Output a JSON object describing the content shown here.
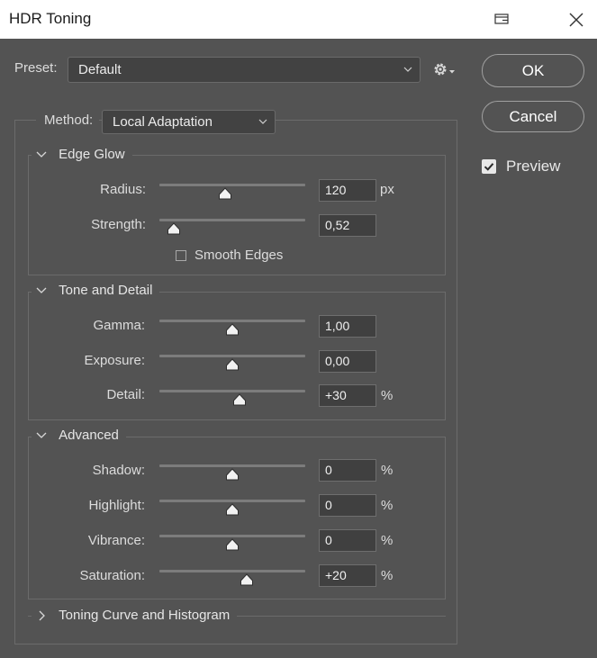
{
  "window": {
    "title": "HDR Toning"
  },
  "preset": {
    "label": "Preset:",
    "value": "Default"
  },
  "buttons": {
    "ok": "OK",
    "cancel": "Cancel"
  },
  "preview": {
    "label": "Preview",
    "checked": true
  },
  "method": {
    "label": "Method:",
    "value": "Local Adaptation"
  },
  "edge_glow": {
    "title": "Edge Glow",
    "radius": {
      "label": "Radius:",
      "value": "120",
      "unit": "px",
      "level": 0.45
    },
    "strength": {
      "label": "Strength:",
      "value": "0,52",
      "unit": "",
      "level": 0.1
    },
    "smooth_edges": {
      "label": "Smooth Edges",
      "checked": false
    }
  },
  "tone_detail": {
    "title": "Tone and Detail",
    "gamma": {
      "label": "Gamma:",
      "value": "1,00",
      "unit": "",
      "level": 0.5
    },
    "exposure": {
      "label": "Exposure:",
      "value": "0,00",
      "unit": "",
      "level": 0.5
    },
    "detail": {
      "label": "Detail:",
      "value": "+30",
      "unit": "%",
      "level": 0.55
    }
  },
  "advanced": {
    "title": "Advanced",
    "shadow": {
      "label": "Shadow:",
      "value": "0",
      "unit": "%",
      "level": 0.5
    },
    "highlight": {
      "label": "Highlight:",
      "value": "0",
      "unit": "%",
      "level": 0.5
    },
    "vibrance": {
      "label": "Vibrance:",
      "value": "0",
      "unit": "%",
      "level": 0.5
    },
    "saturation": {
      "label": "Saturation:",
      "value": "+20",
      "unit": "%",
      "level": 0.6
    }
  },
  "toning_curve": {
    "title": "Toning Curve and Histogram"
  }
}
